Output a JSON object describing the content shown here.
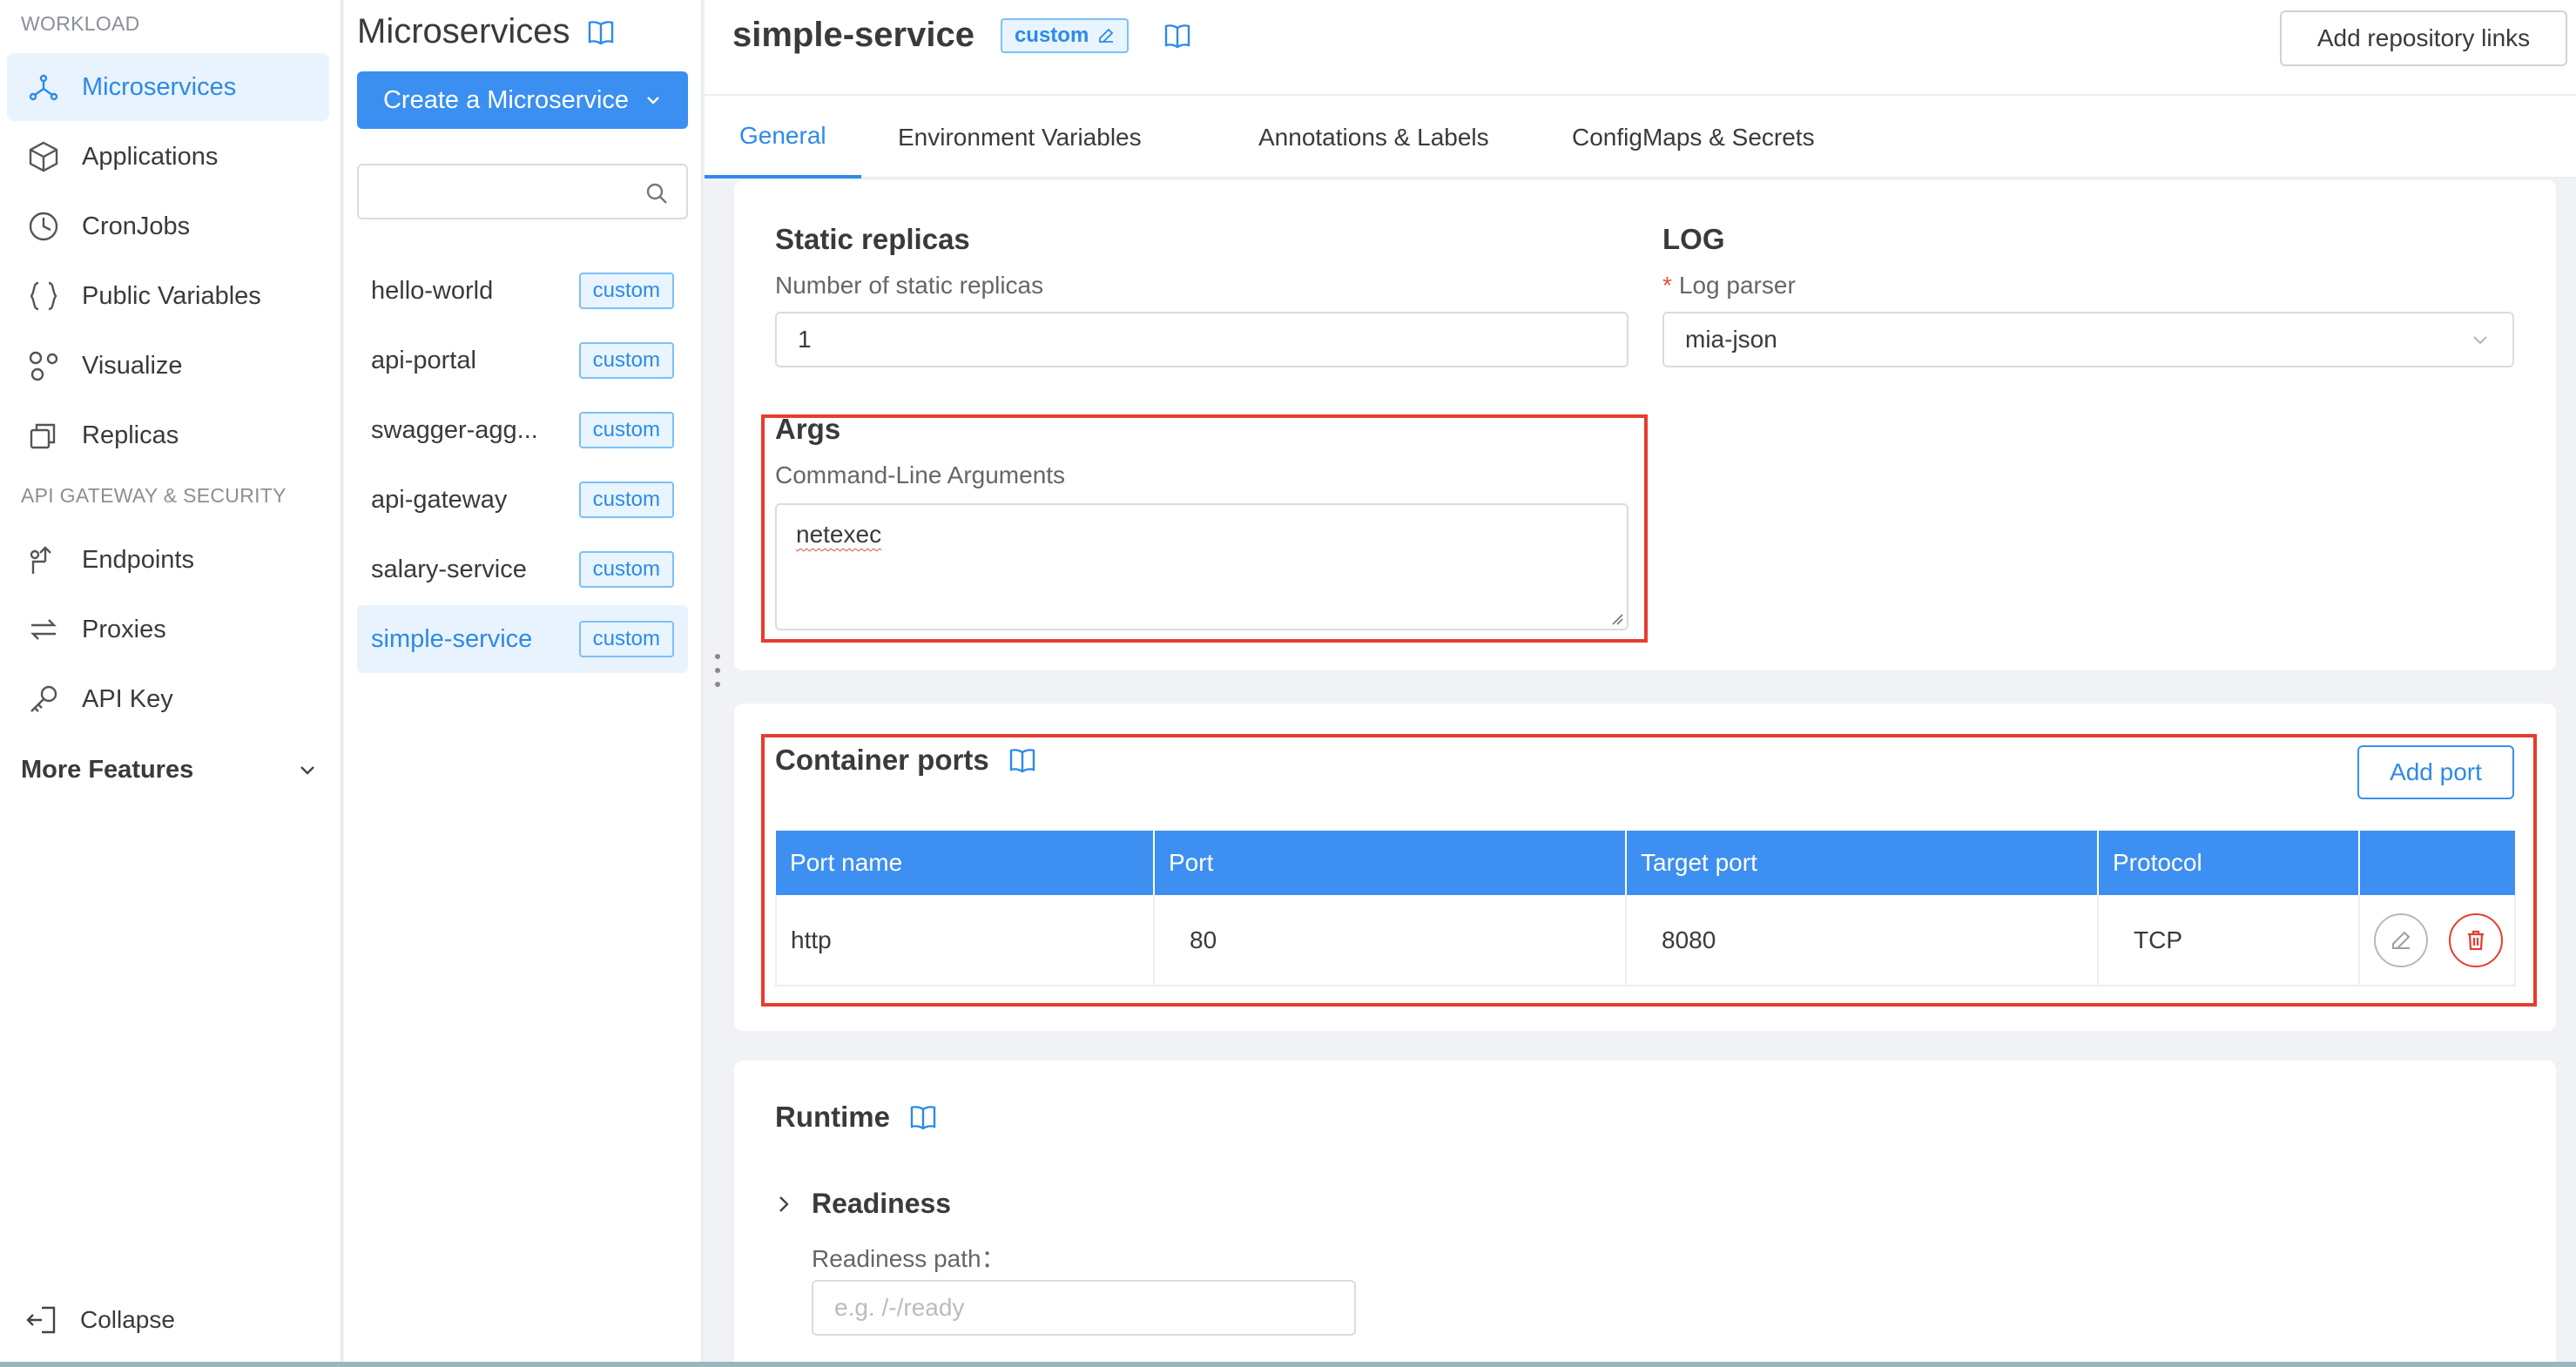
{
  "nav": {
    "sections": [
      {
        "label": "WORKLOAD"
      },
      {
        "label": "API GATEWAY & SECURITY"
      }
    ],
    "workload_items": [
      {
        "label": "Microservices",
        "icon": "microservices-icon",
        "active": true
      },
      {
        "label": "Applications",
        "icon": "cube-icon",
        "active": false
      },
      {
        "label": "CronJobs",
        "icon": "clock-icon",
        "active": false
      },
      {
        "label": "Public Variables",
        "icon": "braces-icon",
        "active": false
      },
      {
        "label": "Visualize",
        "icon": "nodes-icon",
        "active": false
      },
      {
        "label": "Replicas",
        "icon": "copy-icon",
        "active": false
      }
    ],
    "gateway_items": [
      {
        "label": "Endpoints",
        "icon": "endpoint-icon"
      },
      {
        "label": "Proxies",
        "icon": "swap-icon"
      },
      {
        "label": "API Key",
        "icon": "key-icon"
      }
    ],
    "more_features": "More Features",
    "collapse": "Collapse"
  },
  "list": {
    "title": "Microservices",
    "create_button": "Create a Microservice",
    "search_placeholder": "",
    "items": [
      {
        "name": "hello-world",
        "tag": "custom"
      },
      {
        "name": "api-portal",
        "tag": "custom"
      },
      {
        "name": "swagger-agg...",
        "tag": "custom"
      },
      {
        "name": "api-gateway",
        "tag": "custom"
      },
      {
        "name": "salary-service",
        "tag": "custom"
      },
      {
        "name": "simple-service",
        "tag": "custom",
        "active": true
      }
    ]
  },
  "header": {
    "title": "simple-service",
    "tag": "custom",
    "repo_button": "Add repository links"
  },
  "tabs": [
    {
      "label": "General",
      "active": true
    },
    {
      "label": "Environment Variables"
    },
    {
      "label": "Annotations & Labels"
    },
    {
      "label": "ConfigMaps & Secrets"
    }
  ],
  "static_replicas": {
    "title": "Static replicas",
    "label": "Number of static replicas",
    "value": "1"
  },
  "log": {
    "title": "LOG",
    "required_mark": "*",
    "label": "Log parser",
    "value": "mia-json"
  },
  "args": {
    "title": "Args",
    "label": "Command-Line Arguments",
    "value": "netexec"
  },
  "ports": {
    "title": "Container ports",
    "add_button": "Add port",
    "columns": [
      "Port name",
      "Port",
      "Target port",
      "Protocol",
      ""
    ],
    "rows": [
      {
        "name": "http",
        "port": "80",
        "target_port": "8080",
        "protocol": "TCP"
      }
    ]
  },
  "runtime": {
    "title": "Runtime",
    "readiness_title": "Readiness",
    "readiness_path_label": "Readiness path：",
    "readiness_path_placeholder": "e.g. /-/ready"
  },
  "colors": {
    "accent": "#2d8ae8",
    "table_header": "#3d8ff1",
    "highlight": "#e53d2e",
    "danger": "#e53d2e"
  }
}
